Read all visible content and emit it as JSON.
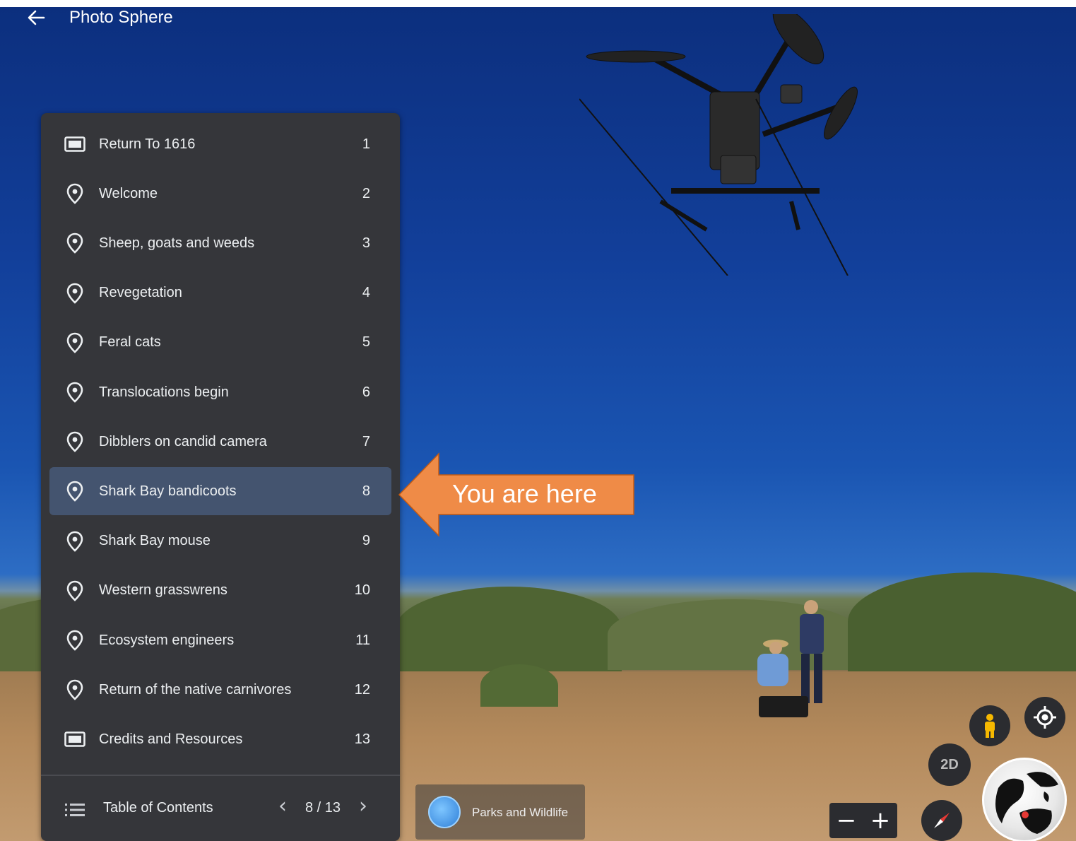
{
  "header": {
    "back_icon": "arrow-left-icon",
    "title": "Photo Sphere"
  },
  "toc": {
    "items": [
      {
        "icon": "slides-icon",
        "label": "Return To 1616",
        "number": "1",
        "active": false
      },
      {
        "icon": "map-pin-icon",
        "label": "Welcome",
        "number": "2",
        "active": false
      },
      {
        "icon": "map-pin-icon",
        "label": "Sheep, goats and weeds",
        "number": "3",
        "active": false
      },
      {
        "icon": "map-pin-icon",
        "label": "Revegetation",
        "number": "4",
        "active": false
      },
      {
        "icon": "map-pin-icon",
        "label": "Feral cats",
        "number": "5",
        "active": false
      },
      {
        "icon": "map-pin-icon",
        "label": "Translocations begin",
        "number": "6",
        "active": false
      },
      {
        "icon": "map-pin-icon",
        "label": "Dibblers on candid camera",
        "number": "7",
        "active": false
      },
      {
        "icon": "map-pin-icon",
        "label": "Shark Bay bandicoots",
        "number": "8",
        "active": true
      },
      {
        "icon": "map-pin-icon",
        "label": "Shark Bay mouse",
        "number": "9",
        "active": false
      },
      {
        "icon": "map-pin-icon",
        "label": "Western grasswrens",
        "number": "10",
        "active": false
      },
      {
        "icon": "map-pin-icon",
        "label": "Ecosystem engineers",
        "number": "11",
        "active": false
      },
      {
        "icon": "map-pin-icon",
        "label": "Return of the native carnivores",
        "number": "12",
        "active": false
      },
      {
        "icon": "slides-icon",
        "label": "Credits and Resources",
        "number": "13",
        "active": false
      }
    ],
    "footer": {
      "title": "Table of Contents",
      "page": "8 / 13",
      "prev_glyph": "‹",
      "next_glyph": "›"
    }
  },
  "callout": {
    "text": "You are here",
    "color": "#ef8b47"
  },
  "attribution": {
    "label": "Parks and Wildlife"
  },
  "controls": {
    "two_d_label": "2D",
    "zoom_out": "−",
    "zoom_in": "+"
  },
  "colors": {
    "panel_bg": "#35363a",
    "active_row": "#44546f",
    "pegman": "#f6b800"
  }
}
